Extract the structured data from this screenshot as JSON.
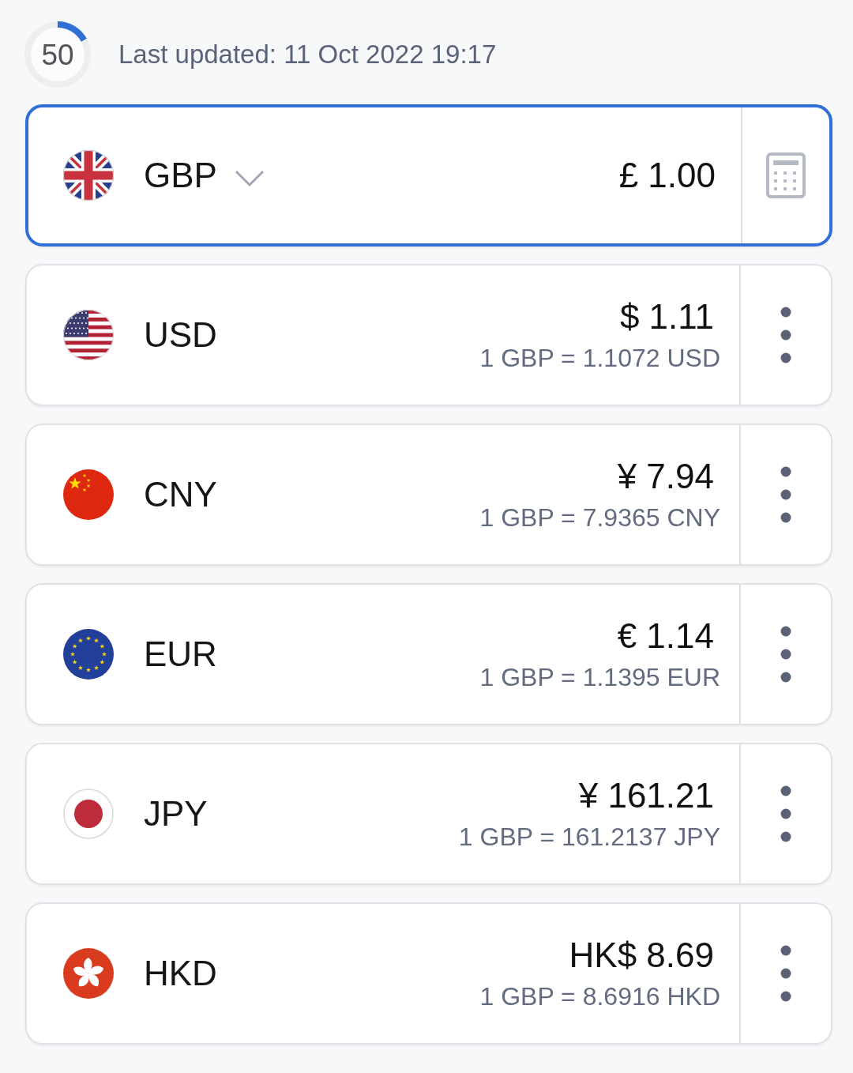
{
  "timer": {
    "count": "50",
    "level": 0.17
  },
  "last_updated": "Last updated: 11 Oct 2022 19:17",
  "cards": [
    {
      "kind": "uk",
      "code": "GBP",
      "amount": "£ 1.00",
      "selected": true
    },
    {
      "kind": "usa",
      "code": "USD",
      "amount": "$ 1.11",
      "rate": "1 GBP = 1.1072 USD",
      "selected": false
    },
    {
      "kind": "china",
      "code": "CNY",
      "amount": "¥ 7.94",
      "rate": "1 GBP = 7.9365 CNY",
      "selected": false
    },
    {
      "kind": "eu",
      "code": "EUR",
      "amount": "€ 1.14",
      "rate": "1 GBP = 1.1395 EUR",
      "selected": false
    },
    {
      "kind": "japan",
      "code": "JPY",
      "amount": "¥ 161.21",
      "rate": "1 GBP = 161.2137 JPY",
      "selected": false
    },
    {
      "kind": "hongkong",
      "code": "HKD",
      "amount": "HK$ 8.69",
      "rate": "1 GBP = 8.6916 HKD",
      "selected": false
    }
  ]
}
